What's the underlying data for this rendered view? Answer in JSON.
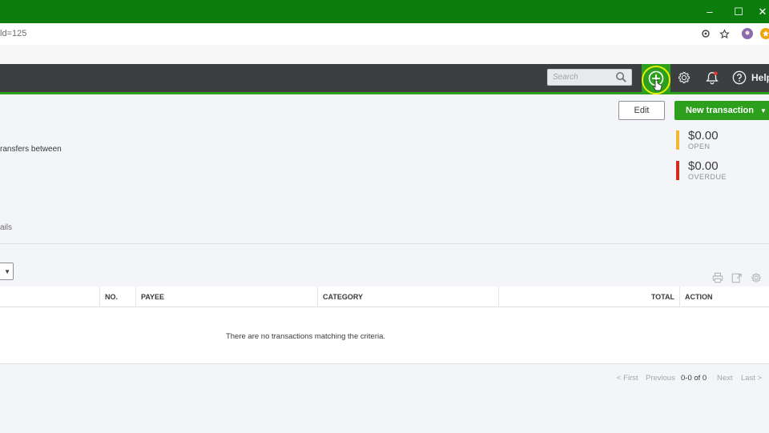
{
  "window": {
    "minimize": "–",
    "maximize": "☐",
    "close": "✕"
  },
  "browser": {
    "url_fragment": "ld=125",
    "icons": [
      "location-icon",
      "star-icon",
      "profile-icon",
      "extension-icon"
    ]
  },
  "topnav": {
    "search_placeholder": "Search",
    "help_label": "Help",
    "plus": "+",
    "icons": [
      "search-icon",
      "plus-icon",
      "gear-icon",
      "bell-icon",
      "help-icon"
    ],
    "accent": "#2ca01c",
    "highlight": "#e8f000"
  },
  "header": {
    "edit_label": "Edit",
    "new_transaction_label": "New transaction",
    "description_fragment": "ransfers between",
    "details_fragment": "ails"
  },
  "summary": [
    {
      "amount": "$0.00",
      "label": "OPEN",
      "color": "#f2b835"
    },
    {
      "amount": "$0.00",
      "label": "OVERDUE",
      "color": "#d52b1e"
    }
  ],
  "table": {
    "columns": [
      "NO.",
      "PAYEE",
      "CATEGORY",
      "TOTAL",
      "ACTION"
    ],
    "empty_message": "There are no transactions matching the criteria."
  },
  "pagination": {
    "first": "< First",
    "previous": "Previous",
    "range": "0-0 of 0",
    "next": "Next",
    "last": "Last >"
  }
}
